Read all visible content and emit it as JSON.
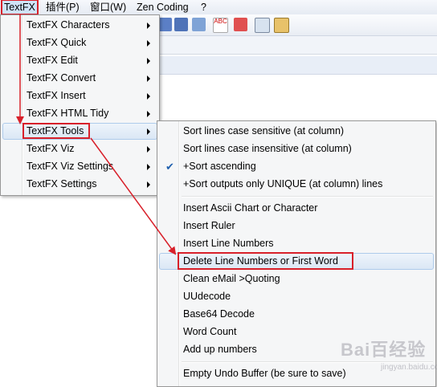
{
  "menubar": {
    "items": [
      "TextFX",
      "插件(P)",
      "窗口(W)",
      "Zen Coding",
      "?"
    ]
  },
  "textfx_menu": {
    "items": [
      {
        "label": "TextFX Characters"
      },
      {
        "label": "TextFX Quick"
      },
      {
        "label": "TextFX Edit"
      },
      {
        "label": "TextFX Convert"
      },
      {
        "label": "TextFX Insert"
      },
      {
        "label": "TextFX HTML Tidy"
      },
      {
        "label": "TextFX Tools"
      },
      {
        "label": "TextFX Viz"
      },
      {
        "label": "TextFX Viz Settings"
      },
      {
        "label": "TextFX Settings"
      }
    ]
  },
  "tools_menu": {
    "items": [
      {
        "label": "Sort lines case sensitive (at column)"
      },
      {
        "label": "Sort lines case insensitive (at column)"
      },
      {
        "label": "+Sort ascending"
      },
      {
        "label": "+Sort outputs only UNIQUE (at column) lines"
      },
      {
        "label": "Insert Ascii Chart or Character"
      },
      {
        "label": "Insert Ruler"
      },
      {
        "label": "Insert Line Numbers"
      },
      {
        "label": "Delete Line Numbers or First Word"
      },
      {
        "label": "Clean eMail >Quoting"
      },
      {
        "label": "UUdecode"
      },
      {
        "label": "Base64 Decode"
      },
      {
        "label": "Word Count"
      },
      {
        "label": "Add up numbers"
      },
      {
        "label": "Empty Undo Buffer (be sure to save)"
      }
    ],
    "checked_index": 2,
    "check_glyph": "✔"
  },
  "watermark": {
    "text": "Bai百经验",
    "sub": "jingyan.baidu.com"
  },
  "colors": {
    "highlight_red": "#d8202a",
    "menu_bg": "#f5f6f7"
  }
}
